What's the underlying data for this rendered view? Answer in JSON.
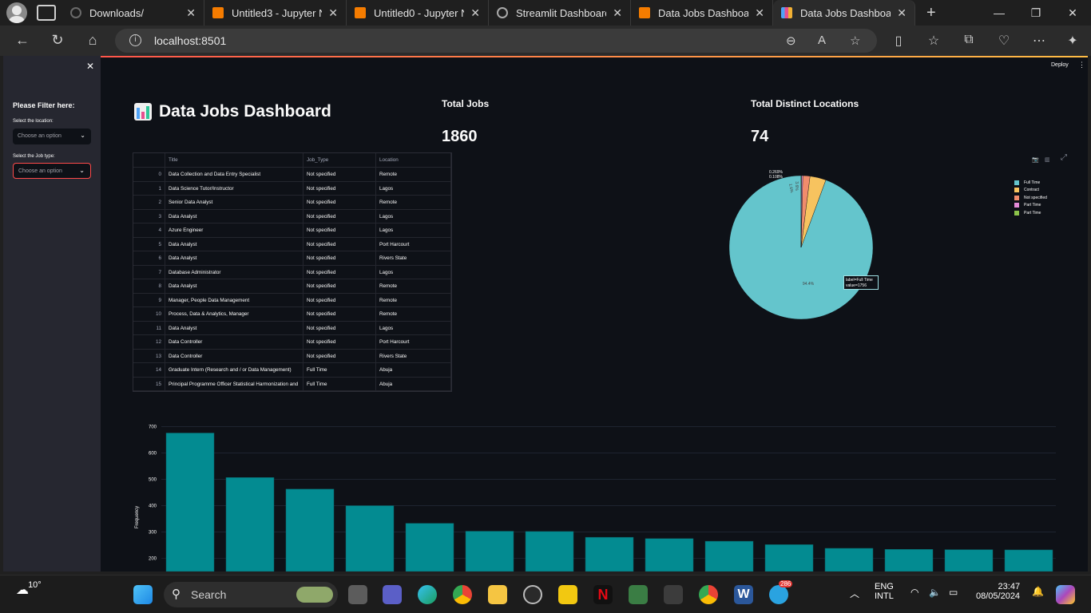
{
  "browser": {
    "tabs": [
      {
        "label": "Downloads/",
        "icon_color": "#6a6a6a"
      },
      {
        "label": "Untitled3 - Jupyter N",
        "icon_color": "#f57c00"
      },
      {
        "label": "Untitled0 - Jupyter N",
        "icon_color": "#f57c00"
      },
      {
        "label": "Streamlit Dashboard",
        "icon_color": "#8a8a8a"
      },
      {
        "label": "Data Jobs Dashboard",
        "icon_color": "#f57c00"
      },
      {
        "label": "Data Jobs Dashboard",
        "icon_color": "#4fa3f7"
      }
    ],
    "url": "localhost:8501"
  },
  "app": {
    "deploy_label": "Deploy",
    "sidebar": {
      "title": "Please Filter here:",
      "location_label": "Select the location:",
      "location_placeholder": "Choose an option",
      "jobtype_label": "Select the Job type:",
      "jobtype_placeholder": "Choose an option"
    },
    "title": "Data Jobs Dashboard",
    "metrics": [
      {
        "label": "Total Jobs",
        "value": "1860"
      },
      {
        "label": "Total Distinct Locations",
        "value": "74"
      }
    ],
    "table": {
      "columns": [
        "",
        "Title",
        "Job_Type",
        "Location"
      ],
      "rows": [
        [
          "0",
          "Data Collection and Data Entry Specialist",
          "Not specified",
          "Remote"
        ],
        [
          "1",
          "Data Science Tutor/Instructor",
          "Not specified",
          "Lagos"
        ],
        [
          "2",
          "Senior Data Analyst",
          "Not specified",
          "Remote"
        ],
        [
          "3",
          "Data Analyst",
          "Not specified",
          "Lagos"
        ],
        [
          "4",
          "Azure Engineer",
          "Not specified",
          "Lagos"
        ],
        [
          "5",
          "Data Analyst",
          "Not specified",
          "Port Harcourt"
        ],
        [
          "6",
          "Data Analyst",
          "Not specified",
          "Rivers State"
        ],
        [
          "7",
          "Database Administrator",
          "Not specified",
          "Lagos"
        ],
        [
          "8",
          "Data Analyst",
          "Not specified",
          "Remote"
        ],
        [
          "9",
          "Manager, People Data Management",
          "Not specified",
          "Remote"
        ],
        [
          "10",
          "Process, Data & Analytics, Manager",
          "Not specified",
          "Remote"
        ],
        [
          "11",
          "Data Analyst",
          "Not specified",
          "Lagos"
        ],
        [
          "12",
          "Data Controller",
          "Not specified",
          "Port Harcourt"
        ],
        [
          "13",
          "Data Controller",
          "Not specified",
          "Rivers State"
        ],
        [
          "14",
          "Graduate Intern (Research and / or Data Management)",
          "Full Time",
          "Abuja"
        ],
        [
          "15",
          "Principal Programme Officer Statistical Harmonization and",
          "Full Time",
          "Abuja"
        ]
      ]
    },
    "pie": {
      "legend": [
        {
          "label": "Full Time",
          "color": "#64c5cc"
        },
        {
          "label": "Contract",
          "color": "#f7c35f"
        },
        {
          "label": "Not specified",
          "color": "#f08c6c"
        },
        {
          "label": "Part Time",
          "color": "#e48ad8"
        },
        {
          "label": "Part Time",
          "color": "#8bc34a"
        }
      ],
      "slice_labels": [
        "94.4%",
        "3.6%",
        "1.6%"
      ],
      "small_labels": [
        "0.269%",
        "0.108%"
      ],
      "tooltip_label": "label=Full Time",
      "tooltip_value": "value=1756"
    },
    "bar": {
      "ylabel": "Frequency",
      "yticks": [
        "700",
        "600",
        "500",
        "400",
        "300",
        "200"
      ]
    }
  },
  "chart_data": [
    {
      "type": "pie",
      "labels": [
        "Full Time",
        "Contract",
        "Not specified",
        "Part Time",
        "Part Time"
      ],
      "values": [
        1756,
        67,
        30,
        5,
        2
      ],
      "slice_labels": [
        "94.4%",
        "3.6%",
        "1.6%",
        "0.269%",
        "0.108%"
      ],
      "legend": "top-right"
    },
    {
      "type": "bar",
      "ylabel": "Frequency",
      "ylim": [
        150,
        720
      ],
      "values": [
        676,
        507,
        463,
        400,
        333,
        303,
        302,
        280,
        275,
        265,
        252,
        238,
        234,
        233,
        232
      ],
      "grid": true
    }
  ],
  "taskbar": {
    "weather": "10°",
    "search": "Search",
    "lang1": "ENG",
    "lang2": "INTL",
    "time": "23:47",
    "date": "08/05/2024",
    "badge": "286"
  }
}
